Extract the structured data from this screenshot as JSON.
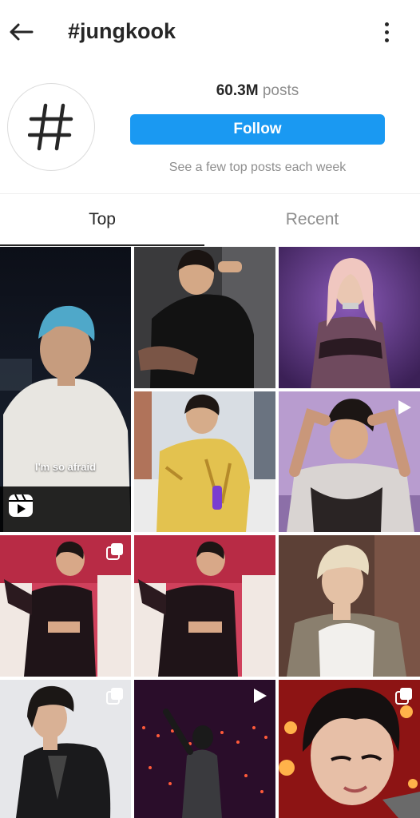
{
  "header": {
    "title": "#jungkook",
    "back_icon": "arrow-left-icon",
    "more_icon": "more-vertical-icon"
  },
  "hashtag": {
    "icon": "hashtag-icon",
    "posts_count": "60.3M",
    "posts_label": "posts",
    "follow_label": "Follow",
    "subtext": "See a few top posts each week"
  },
  "tabs": [
    {
      "label": "Top",
      "active": true
    },
    {
      "label": "Recent",
      "active": false
    }
  ],
  "colors": {
    "accent": "#1a99f2",
    "text": "#262626",
    "muted": "#8e8e8e"
  },
  "grid": {
    "tiles": [
      {
        "desc": "person-blue-hair-white-tshirt",
        "badge": "reel-icon",
        "caption": "I'm so afraid"
      },
      {
        "desc": "person-black-shirt-car",
        "badge": ""
      },
      {
        "desc": "person-floral-dress-purple",
        "badge": ""
      },
      {
        "desc": "person-yellow-shirt-sofa",
        "badge": ""
      },
      {
        "desc": "person-hands-head-stage",
        "badge": "play-icon"
      },
      {
        "desc": "performer-red-stage-left",
        "badge": "carousel-icon"
      },
      {
        "desc": "performer-red-stage-right",
        "badge": ""
      },
      {
        "desc": "person-blond-hair-brick-wall",
        "badge": ""
      },
      {
        "desc": "person-leather-jacket-grey",
        "badge": "carousel-icon"
      },
      {
        "desc": "performer-dark-stage-lights",
        "badge": "play-icon"
      },
      {
        "desc": "closeup-face-red-lights",
        "badge": "carousel-icon"
      }
    ]
  }
}
